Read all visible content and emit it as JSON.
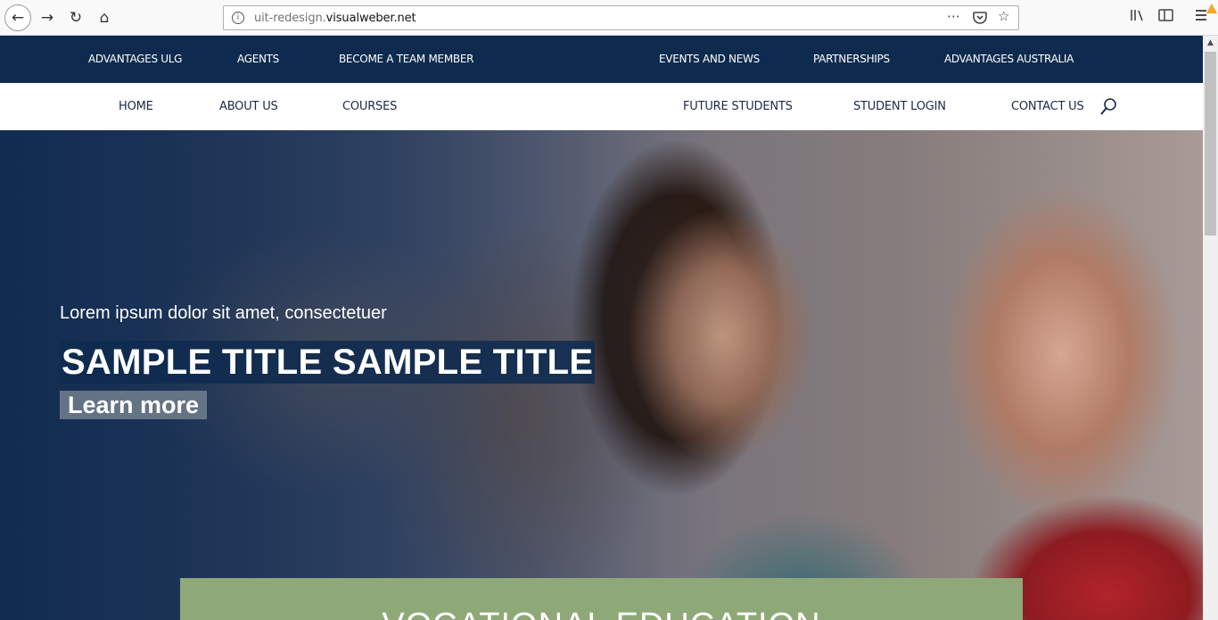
{
  "browser": {
    "url_prefix": "uit-redesign.",
    "url_domain": "visualweber.net",
    "info_icon": "info-icon",
    "back_icon": "back-arrow-icon",
    "forward_icon": "forward-arrow-icon",
    "reload_icon": "reload-icon",
    "home_icon": "home-icon",
    "page_actions_icon": "more-dots-icon",
    "pocket_icon": "pocket-icon",
    "bookmark_icon": "star-icon",
    "library_icon": "library-icon",
    "sidebar_icon": "sidebar-icon",
    "menu_icon": "hamburger-menu-icon"
  },
  "topnav": {
    "items": [
      {
        "label": "ADVANTAGES ULG"
      },
      {
        "label": "AGENTS"
      },
      {
        "label": "BECOME A TEAM MEMBER"
      },
      {
        "label": "EVENTS AND NEWS"
      },
      {
        "label": "PARTNERSHIPS"
      },
      {
        "label": "ADVANTAGES AUSTRALIA"
      }
    ]
  },
  "mainnav": {
    "items": [
      {
        "label": "HOME"
      },
      {
        "label": "ABOUT US"
      },
      {
        "label": "COURSES"
      },
      {
        "label": "FUTURE STUDENTS"
      },
      {
        "label": "STUDENT LOGIN"
      },
      {
        "label": "CONTACT US"
      }
    ],
    "search_icon": "search-icon"
  },
  "hero": {
    "subtitle": "Lorem ipsum dolor sit amet, consectetuer",
    "title": "SAMPLE TITLE SAMPLE TITLE",
    "button_label": "Learn more",
    "panel_title": "VOCATIONAL EDUCATION"
  },
  "colors": {
    "navy": "#0e2a4f",
    "green_panel": "#8fa878",
    "button_gray": "#6e7d8c"
  }
}
